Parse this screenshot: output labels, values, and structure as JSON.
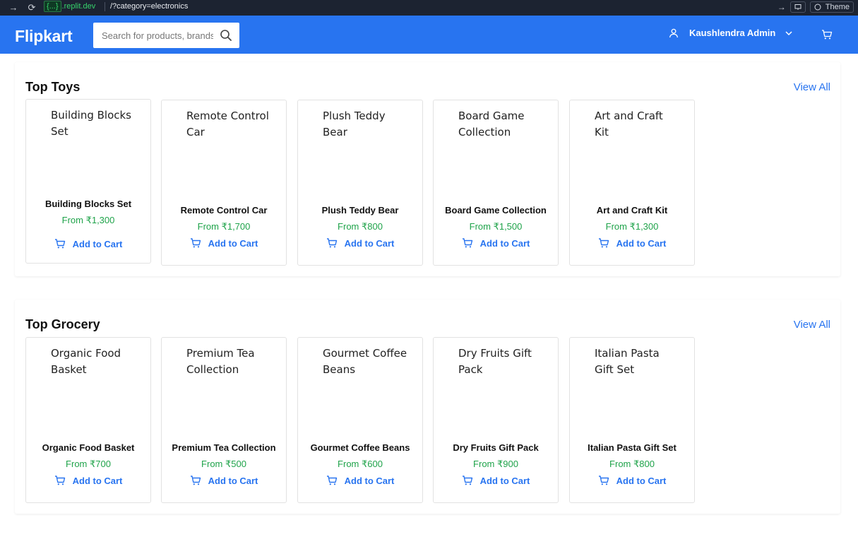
{
  "browser": {
    "url_domain": "{...}",
    "url_domain_rest": ".replit.dev",
    "url_path": "/?category=electronics",
    "theme_label": "Theme"
  },
  "header": {
    "logo": "Flipkart",
    "search_placeholder": "Search for products, brands and more",
    "user_name": "Kaushlendra Admin",
    "brand_color": "#2874f0"
  },
  "sections": [
    {
      "title": "Top Toys",
      "view_all": "View All",
      "products": [
        {
          "alt": "Building Blocks Set",
          "name": "Building Blocks Set",
          "price": "From ₹1,300",
          "cta": "Add to Cart"
        },
        {
          "alt": "Remote Control Car",
          "name": "Remote Control Car",
          "price": "From ₹1,700",
          "cta": "Add to Cart"
        },
        {
          "alt": "Plush Teddy Bear",
          "name": "Plush Teddy Bear",
          "price": "From ₹800",
          "cta": "Add to Cart"
        },
        {
          "alt": "Board Game Collection",
          "name": "Board Game Collection",
          "price": "From ₹1,500",
          "cta": "Add to Cart"
        },
        {
          "alt": "Art and Craft Kit",
          "name": "Art and Craft Kit",
          "price": "From ₹1,300",
          "cta": "Add to Cart"
        }
      ]
    },
    {
      "title": "Top Grocery",
      "view_all": "View All",
      "products": [
        {
          "alt": "Organic Food Basket",
          "name": "Organic Food Basket",
          "price": "From ₹700",
          "cta": "Add to Cart"
        },
        {
          "alt": "Premium Tea Collection",
          "name": "Premium Tea Collection",
          "price": "From ₹500",
          "cta": "Add to Cart"
        },
        {
          "alt": "Gourmet Coffee Beans",
          "name": "Gourmet Coffee Beans",
          "price": "From ₹600",
          "cta": "Add to Cart"
        },
        {
          "alt": "Dry Fruits Gift Pack",
          "name": "Dry Fruits Gift Pack",
          "price": "From ₹900",
          "cta": "Add to Cart"
        },
        {
          "alt": "Italian Pasta Gift Set",
          "name": "Italian Pasta Gift Set",
          "price": "From ₹800",
          "cta": "Add to Cart"
        }
      ]
    }
  ]
}
